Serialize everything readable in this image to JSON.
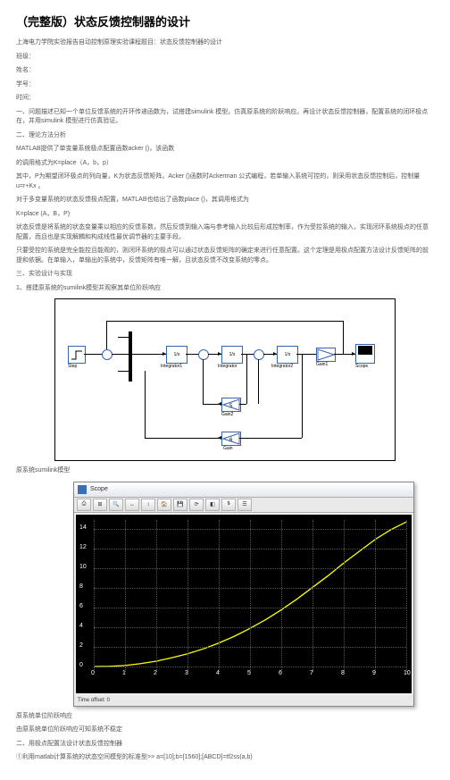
{
  "title": "（完整版）状态反馈控制器的设计",
  "header_line": "上海电力学院实验报告自动控制原理实验课程题目：状态反馈控制器的设计",
  "meta": {
    "class": "班级：",
    "name": "姓名：",
    "id": "学号：",
    "time": "时间："
  },
  "sections": {
    "s1": "一、问题描述已知一个单位反馈系统的开环传递函数为，试搭建simulink 模型。仿真原系统的阶跃响应。再设计状态反馈控制器，配置系统的闭环极点在，并用simulink 模型进行仿真验证。",
    "s2": "二、理论方法分析",
    "p1": "MATLAB提供了单变量系统极点配置函数acker ()，该函数",
    "p2": "的调用格式为K=place（A，b，p）",
    "p3": "其中，P为期望闭环极点的列向量，K为状态反馈矩阵。Acker ()函数时Ackerman 公式编程，若单输入系统可控的，则采用状态反馈控制后，控制量u=r+Kx 。",
    "p4": "对于多变量系统的状态反馈极点配置，MATLAB也给出了函数place ()，其调用格式为",
    "p5": "K=place (A，B，P)",
    "p6": "状态反馈是将系统的状态变量乘以相应的反馈系数，然后反馈到输入端与参考输入比较后形成控制率，作为受控系统的输入，实现闭环系统极点的任意配置，而且也是实现解耦和构成线性最优调节器的主要手段。",
    "p7": "只要受控的系统是完全能控且能观的，则闭环系统的极点可以通过状态反馈矩阵的确定来进行任意配置。这个定理是用极点配置方法设计反馈矩阵的前提和依据。在单输入，单输出的系统中，反馈矩阵有唯一解，且状态反馈不改变系统的零点。",
    "s3": "三、实验设计与实现",
    "p8": "1、搭建原系统的sumilink模型并观察其单位阶跃响应",
    "caption1": "原系统sumilink模型",
    "caption2": "原系统单位阶跃响应",
    "p9": "由原系统单位阶跃响应可知系统不稳定",
    "p10": "二、用极点配置法设计状态反馈控制器",
    "p11": "①利用matlab计算系统的状态空间模型的标准型>> a=[10];b=[1560];[ABCD]=tf2ss(a,b)"
  },
  "diagram": {
    "step": "Step",
    "int1": "Integrator1",
    "int": "Integrator",
    "int2": "Integrator2",
    "gain1": "Gain1",
    "scope": "Scope",
    "gain2": "Gain2",
    "gain": "Gain",
    "int_sym": "1/s",
    "k1": "5",
    "k2": "6"
  },
  "scope": {
    "title": "Scope",
    "status": "Time offset: 0"
  },
  "chart_data": {
    "type": "line",
    "title": "",
    "xlabel": "",
    "ylabel": "",
    "xlim": [
      0,
      10
    ],
    "ylim": [
      0,
      15
    ],
    "xticks": [
      0,
      1,
      2,
      3,
      4,
      5,
      6,
      7,
      8,
      9,
      10
    ],
    "yticks": [
      0,
      2,
      4,
      6,
      8,
      10,
      12,
      14
    ],
    "x": [
      0,
      0.5,
      1,
      1.5,
      2,
      2.5,
      3,
      3.5,
      4,
      4.5,
      5,
      5.5,
      6,
      6.5,
      7,
      7.5,
      8,
      8.5,
      9,
      9.5,
      10
    ],
    "y": [
      0,
      0.02,
      0.1,
      0.3,
      0.55,
      0.9,
      1.3,
      1.8,
      2.4,
      3.1,
      3.9,
      4.8,
      5.8,
      6.9,
      8.1,
      9.3,
      10.6,
      11.8,
      13.0,
      14.0,
      14.8
    ]
  }
}
